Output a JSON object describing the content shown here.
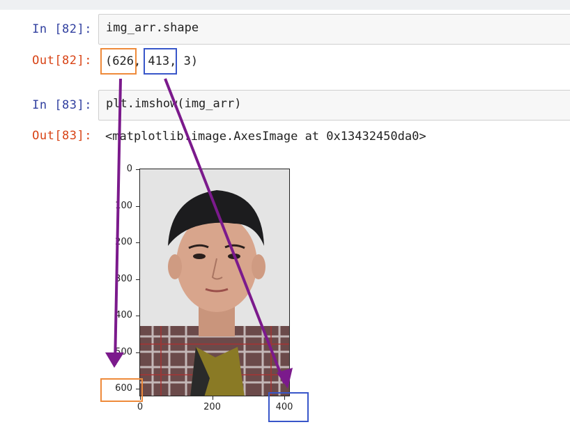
{
  "cells": [
    {
      "in_prompt": "In  [82]:",
      "code": "img_arr.shape",
      "out_prompt": "Out[82]:",
      "output": "(626, 413, 3)"
    },
    {
      "in_prompt": "In  [83]:",
      "code": "plt.imshow(img_arr)",
      "out_prompt": "Out[83]:",
      "output": "<matplotlib.image.AxesImage at 0x13432450da0>"
    }
  ],
  "highlights": {
    "height_value": "600",
    "width_value": "400"
  },
  "plot": {
    "y_ticks": [
      "0",
      "100",
      "200",
      "300",
      "400",
      "500",
      "600"
    ],
    "x_ticks": [
      "0",
      "200",
      "400"
    ]
  },
  "colors": {
    "prompt_in": "#303f9f",
    "prompt_out": "#d84315",
    "highlight_orange": "#ee8a3a",
    "highlight_blue": "#3856c9",
    "arrow": "#7b1a8c"
  }
}
